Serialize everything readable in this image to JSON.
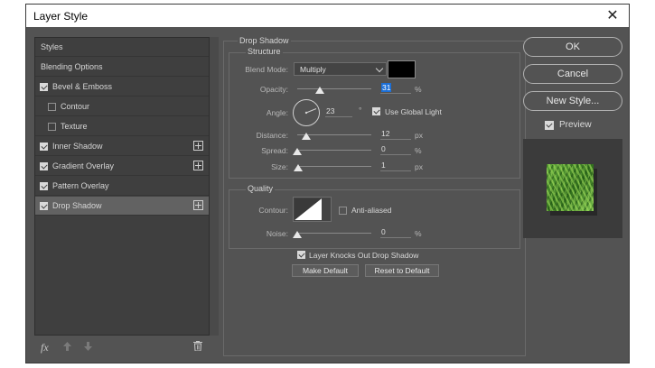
{
  "window": {
    "title": "Layer Style",
    "close_glyph": "✕"
  },
  "styles_list": [
    {
      "label": "Styles",
      "checkbox": null,
      "plus": false,
      "selected": false,
      "indent": false
    },
    {
      "label": "Blending Options",
      "checkbox": null,
      "plus": false,
      "selected": false,
      "indent": false
    },
    {
      "label": "Bevel & Emboss",
      "checkbox": true,
      "plus": false,
      "selected": false,
      "indent": false
    },
    {
      "label": "Contour",
      "checkbox": false,
      "plus": false,
      "selected": false,
      "indent": true
    },
    {
      "label": "Texture",
      "checkbox": false,
      "plus": false,
      "selected": false,
      "indent": true
    },
    {
      "label": "Inner Shadow",
      "checkbox": true,
      "plus": true,
      "selected": false,
      "indent": false
    },
    {
      "label": "Gradient Overlay",
      "checkbox": true,
      "plus": true,
      "selected": false,
      "indent": false
    },
    {
      "label": "Pattern Overlay",
      "checkbox": true,
      "plus": false,
      "selected": false,
      "indent": false
    },
    {
      "label": "Drop Shadow",
      "checkbox": true,
      "plus": true,
      "selected": true,
      "indent": false
    }
  ],
  "bottom_tools": {
    "fx": "fx",
    "trash_glyph": "🗑"
  },
  "drop_shadow": {
    "section_title": "Drop Shadow",
    "structure_title": "Structure",
    "blend_mode_label": "Blend Mode:",
    "blend_mode_value": "Multiply",
    "shadow_color": "#000000",
    "opacity_label": "Opacity:",
    "opacity_value": "31",
    "opacity_unit": "%",
    "angle_label": "Angle:",
    "angle_value": "23",
    "angle_unit": "°",
    "use_global_light_label": "Use Global Light",
    "use_global_light": true,
    "distance_label": "Distance:",
    "distance_value": "12",
    "distance_unit": "px",
    "spread_label": "Spread:",
    "spread_value": "0",
    "spread_unit": "%",
    "size_label": "Size:",
    "size_value": "1",
    "size_unit": "px"
  },
  "quality": {
    "title": "Quality",
    "contour_label": "Contour:",
    "anti_aliased_label": "Anti-aliased",
    "anti_aliased": false,
    "noise_label": "Noise:",
    "noise_value": "0",
    "noise_unit": "%"
  },
  "knockout": {
    "label": "Layer Knocks Out Drop Shadow",
    "checked": true
  },
  "make_default_label": "Make Default",
  "reset_default_label": "Reset to Default",
  "right": {
    "ok_label": "OK",
    "cancel_label": "Cancel",
    "new_style_label": "New Style...",
    "preview_label": "Preview",
    "preview_checked": true
  }
}
